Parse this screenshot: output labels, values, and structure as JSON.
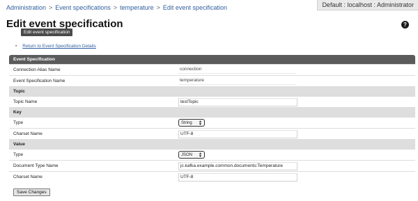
{
  "breadcrumb": {
    "items": [
      "Administration",
      "Event specifications",
      "temperature",
      "Edit event specification"
    ],
    "separator": ">"
  },
  "user": {
    "context": "Default : localhost : Administrator"
  },
  "page": {
    "title": "Edit event specification",
    "tooltip": "Edit event specification",
    "help_icon": "help-icon"
  },
  "links": {
    "return": "Return to Event Specification Details"
  },
  "form": {
    "header": "Event Specification",
    "connection_alias_label": "Connection Alias Name",
    "connection_alias_value": "connection",
    "event_spec_name_label": "Event Specification Name",
    "event_spec_name_value": "temperature",
    "topic_section": "Topic",
    "topic_name_label": "Topic Name",
    "topic_name_value": "testTopic",
    "key_section": "Key",
    "key_type_label": "Type",
    "key_type_value": "String",
    "key_charset_label": "Charset Name",
    "key_charset_value": "UTF-8",
    "value_section": "Value",
    "value_type_label": "Type",
    "value_type_value": "JSON",
    "doc_type_label": "Document Type Name",
    "doc_type_value": "jc.kafka.example.common.documents:Temperature",
    "value_charset_label": "Charset Name",
    "value_charset_value": "UTF-8"
  },
  "actions": {
    "save": "Save Changes"
  }
}
